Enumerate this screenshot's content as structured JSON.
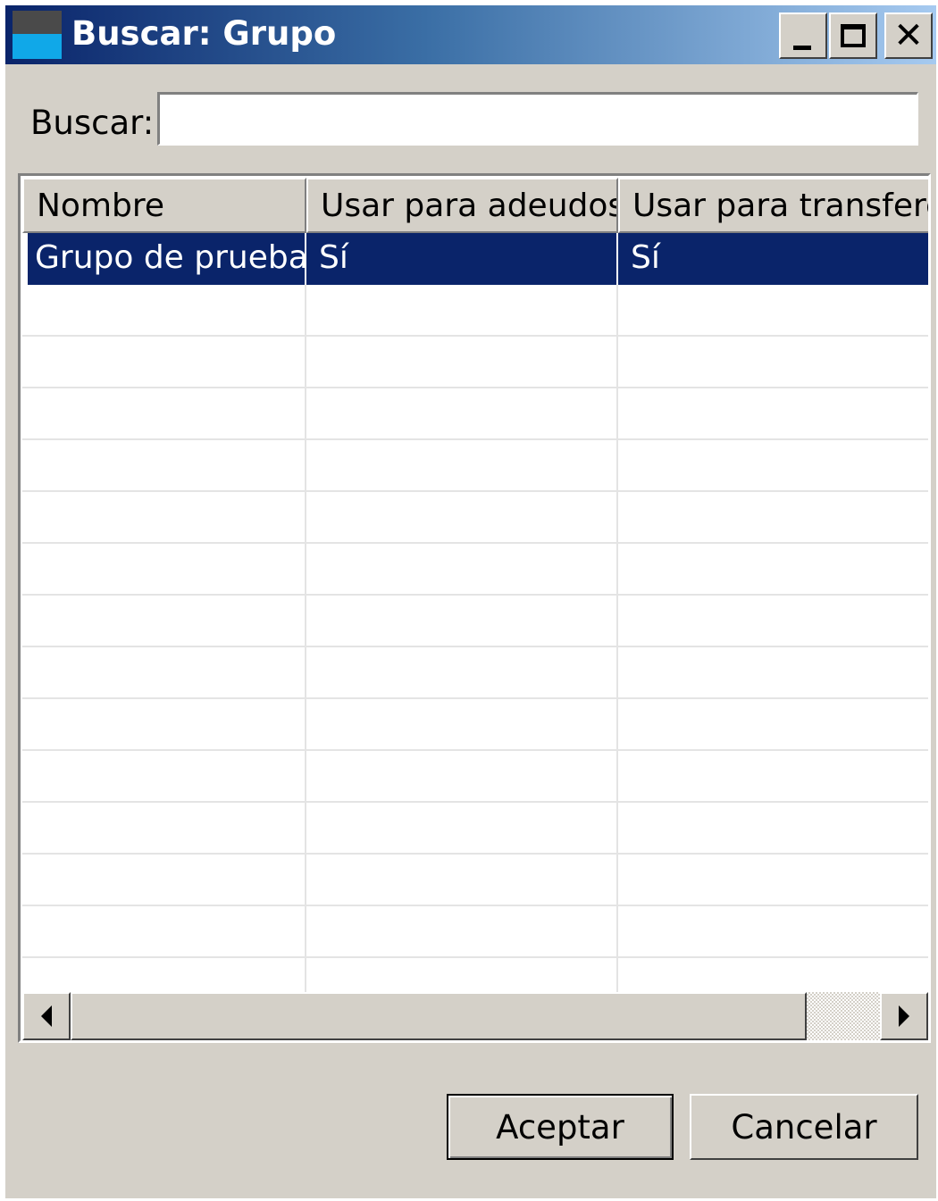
{
  "window": {
    "title": "Buscar: Grupo",
    "minimize_glyph": "_",
    "close_glyph": "✕"
  },
  "search": {
    "label": "Buscar:",
    "value": "",
    "placeholder": ""
  },
  "table": {
    "columns": [
      "Nombre",
      "Usar para adeudos",
      "Usar para transferencias"
    ],
    "rows": [
      {
        "nombre": "Grupo de prueba",
        "adeudos": "Sí",
        "transferencias": "Sí",
        "selected": true
      }
    ]
  },
  "buttons": {
    "accept": "Aceptar",
    "cancel": "Cancelar"
  },
  "colors": {
    "selection": "#0a246a",
    "face": "#d4d0c8"
  }
}
